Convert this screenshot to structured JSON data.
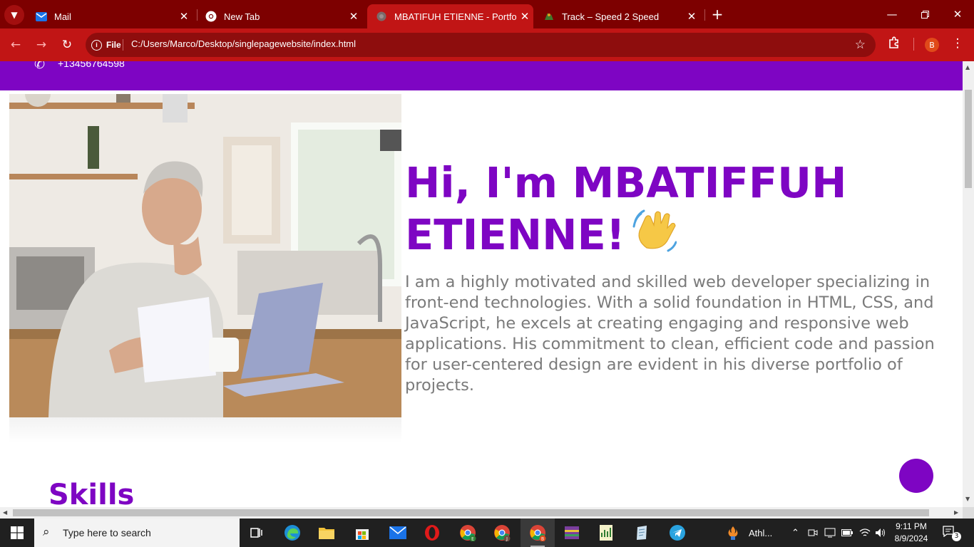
{
  "browser": {
    "tabs": [
      {
        "label": "Mail",
        "icon": "mail-icon",
        "active": false
      },
      {
        "label": "New Tab",
        "icon": "chrome-icon",
        "active": false
      },
      {
        "label": "MBATIFUH ETIENNE - Portfolio",
        "icon": "globe-icon",
        "active": true
      },
      {
        "label": "Track – Speed 2 Speed",
        "icon": "speed-icon",
        "active": false
      }
    ],
    "address": {
      "scheme_label": "File",
      "url": "C:/Users/Marco/Desktop/singlepagewebsite/index.html"
    },
    "profile_initial": "B",
    "theme_color": "#c11515"
  },
  "page": {
    "phone": "+13456764598",
    "hero_title_line1": "Hi, I'm MBATIFFUH",
    "hero_title_line2": "ETIENNE!",
    "hero_emoji": "waving-hand",
    "hero_text": "I am a highly motivated and skilled web developer specializing in front-end technologies. With a solid foundation in HTML, CSS, and JavaScript, he excels at creating engaging and responsive web applications. His commitment to clean, efficient code and passion for user-centered design are evident in his diverse portfolio of projects.",
    "skills_heading": "Skills",
    "accent_color": "#7e05c3",
    "text_color": "#7a7a7a"
  },
  "taskbar": {
    "search_placeholder": "Type here to search",
    "weather_label": "Athl...",
    "time": "9:11 PM",
    "date": "8/9/2024",
    "notification_count": "3"
  }
}
